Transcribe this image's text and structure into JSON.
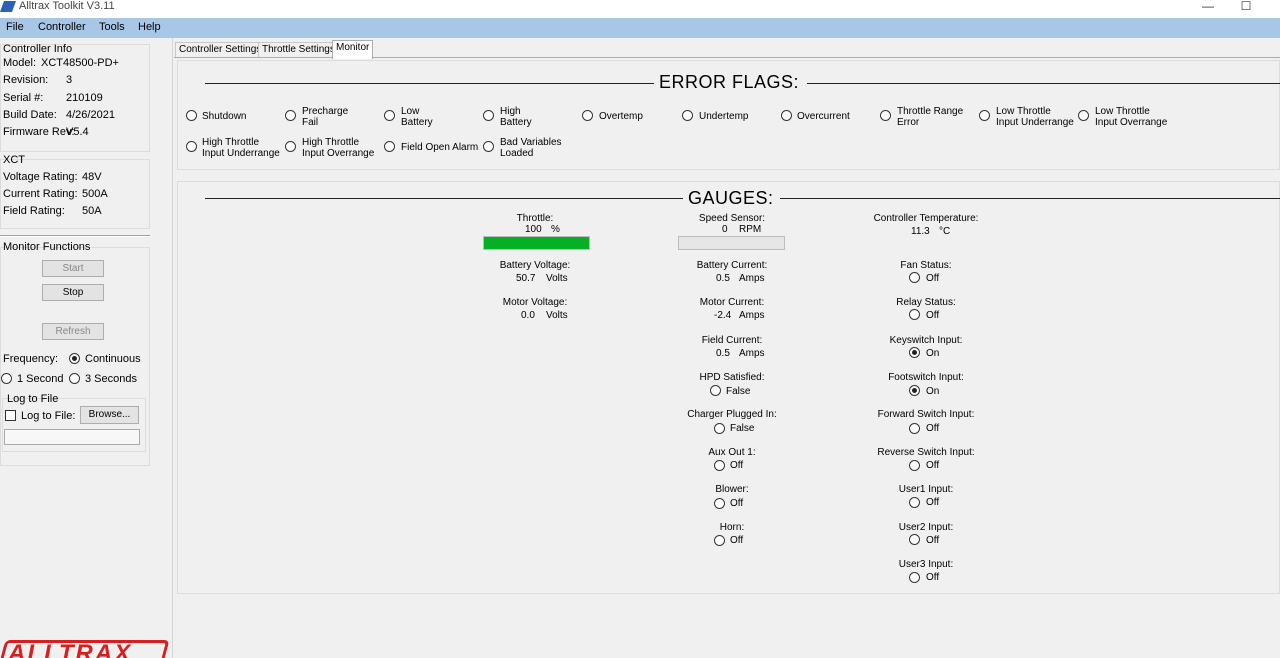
{
  "window": {
    "title": "Alltrax Toolkit V3.11",
    "minimize_glyph": "—",
    "maximize_glyph": "☐"
  },
  "menu": [
    "File",
    "Controller",
    "Tools",
    "Help"
  ],
  "controller_info": {
    "title": "Controller Info",
    "rows": [
      {
        "label": "Model:",
        "value": "XCT48500-PD+"
      },
      {
        "label": "Revision:",
        "value": "3"
      },
      {
        "label": "Serial #:",
        "value": "210109"
      },
      {
        "label": "Build Date:",
        "value": "4/26/2021"
      },
      {
        "label": "Firmware Rev:",
        "value": "V5.4"
      }
    ]
  },
  "xct": {
    "title": "XCT",
    "rows": [
      {
        "label": "Voltage Rating:",
        "value": "48V"
      },
      {
        "label": "Current Rating:",
        "value": "500A"
      },
      {
        "label": "Field Rating:",
        "value": "50A"
      }
    ]
  },
  "monitor_functions": {
    "title": "Monitor Functions",
    "start_label": "Start",
    "stop_label": "Stop",
    "refresh_label": "Refresh",
    "frequency_label": "Frequency:",
    "continuous_label": "Continuous",
    "one_second_label": "1 Second",
    "three_seconds_label": "3 Seconds",
    "selected_frequency": "Continuous",
    "log_title": "Log to File",
    "log_checkbox_label": "Log to File:",
    "log_checked": false,
    "browse_label": "Browse...",
    "log_path": ""
  },
  "logo_text": "ALLTRAX",
  "tabs": [
    "Controller Settings",
    "Throttle Settings",
    "Monitor"
  ],
  "active_tab": "Monitor",
  "error_flags": {
    "title": "ERROR FLAGS:",
    "flags": [
      {
        "l1": "Shutdown",
        "l2": ""
      },
      {
        "l1": "Precharge",
        "l2": "Fail"
      },
      {
        "l1": "Low",
        "l2": "Battery"
      },
      {
        "l1": "High",
        "l2": "Battery"
      },
      {
        "l1": "Overtemp",
        "l2": ""
      },
      {
        "l1": "Undertemp",
        "l2": ""
      },
      {
        "l1": "Overcurrent",
        "l2": ""
      },
      {
        "l1": "Throttle Range",
        "l2": "Error"
      },
      {
        "l1": "Low Throttle",
        "l2": "Input Underrange"
      },
      {
        "l1": "Low Throttle",
        "l2": "Input Overrange"
      },
      {
        "l1": "High Throttle",
        "l2": "Input Underrange"
      },
      {
        "l1": "High Throttle",
        "l2": "Input Overrange"
      },
      {
        "l1": "Field Open Alarm",
        "l2": ""
      },
      {
        "l1": "Bad Variables",
        "l2": "Loaded"
      }
    ]
  },
  "gauges": {
    "title": "GAUGES:",
    "throttle": {
      "label": "Throttle:",
      "value": "100",
      "unit": "%",
      "fill": 1.0
    },
    "battery_voltage": {
      "label": "Battery Voltage:",
      "value": "50.7",
      "unit": "Volts"
    },
    "motor_voltage": {
      "label": "Motor Voltage:",
      "value": "0.0",
      "unit": "Volts"
    },
    "speed_sensor": {
      "label": "Speed Sensor:",
      "value": "0",
      "unit": "RPM",
      "fill": 0.0
    },
    "battery_current": {
      "label": "Battery Current:",
      "value": "0.5",
      "unit": "Amps"
    },
    "motor_current": {
      "label": "Motor Current:",
      "value": "-2.4",
      "unit": "Amps"
    },
    "field_current": {
      "label": "Field Current:",
      "value": "0.5",
      "unit": "Amps"
    },
    "hpd_satisfied": {
      "label": "HPD Satisfied:",
      "value": "False",
      "on": false
    },
    "charger_plugged": {
      "label": "Charger Plugged In:",
      "value": "False",
      "on": false
    },
    "aux_out_1": {
      "label": "Aux Out 1:",
      "value": "Off",
      "on": false
    },
    "blower": {
      "label": "Blower:",
      "value": "Off",
      "on": false
    },
    "horn": {
      "label": "Horn:",
      "value": "Off",
      "on": false
    },
    "controller_temp": {
      "label": "Controller Temperature:",
      "value": "11.3",
      "unit": "°C"
    },
    "fan_status": {
      "label": "Fan Status:",
      "value": "Off",
      "on": false
    },
    "relay_status": {
      "label": "Relay Status:",
      "value": "Off",
      "on": false
    },
    "keyswitch_input": {
      "label": "Keyswitch Input:",
      "value": "On",
      "on": true
    },
    "footswitch_input": {
      "label": "Footswitch Input:",
      "value": "On",
      "on": true
    },
    "forward_switch": {
      "label": "Forward Switch Input:",
      "value": "Off",
      "on": false
    },
    "reverse_switch": {
      "label": "Reverse Switch Input:",
      "value": "Off",
      "on": false
    },
    "user1_input": {
      "label": "User1 Input:",
      "value": "Off",
      "on": false
    },
    "user2_input": {
      "label": "User2 Input:",
      "value": "Off",
      "on": false
    },
    "user3_input": {
      "label": "User3 Input:",
      "value": "Off",
      "on": false
    }
  }
}
